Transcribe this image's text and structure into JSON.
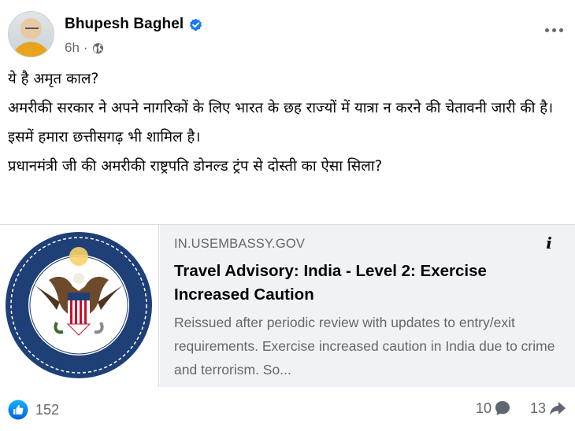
{
  "post": {
    "author": "Bhupesh Baghel",
    "time": "6h",
    "separator": "·",
    "paragraphs": [
      "ये है अमृत काल?",
      "अमरीकी सरकार ने अपने नागरिकों के लिए भारत के  छह राज्यों में यात्रा न करने की चेतावनी जारी की है।",
      "इसमें हमारा छत्तीसगढ़ भी शामिल है।",
      "प्रधानमंत्री जी की अमरीकी राष्ट्रपति डोनल्ड ट्रंप से दोस्ती का ऐसा सिला?"
    ]
  },
  "link_card": {
    "domain": "IN.USEMBASSY.GOV",
    "title": "Travel Advisory: India - Level 2: Exercise Increased Caution",
    "description": "Reissued after periodic review with updates to entry/exit requirements. Exercise increased caution in India due to crime and terrorism. So...",
    "info_label": "i",
    "image_icon": "department-of-state-seal"
  },
  "stats": {
    "likes": "152",
    "comments": "10",
    "shares": "13"
  },
  "colors": {
    "accent": "#1877f2",
    "secondary_text": "#65676b",
    "card_background": "#f0f2f5"
  }
}
